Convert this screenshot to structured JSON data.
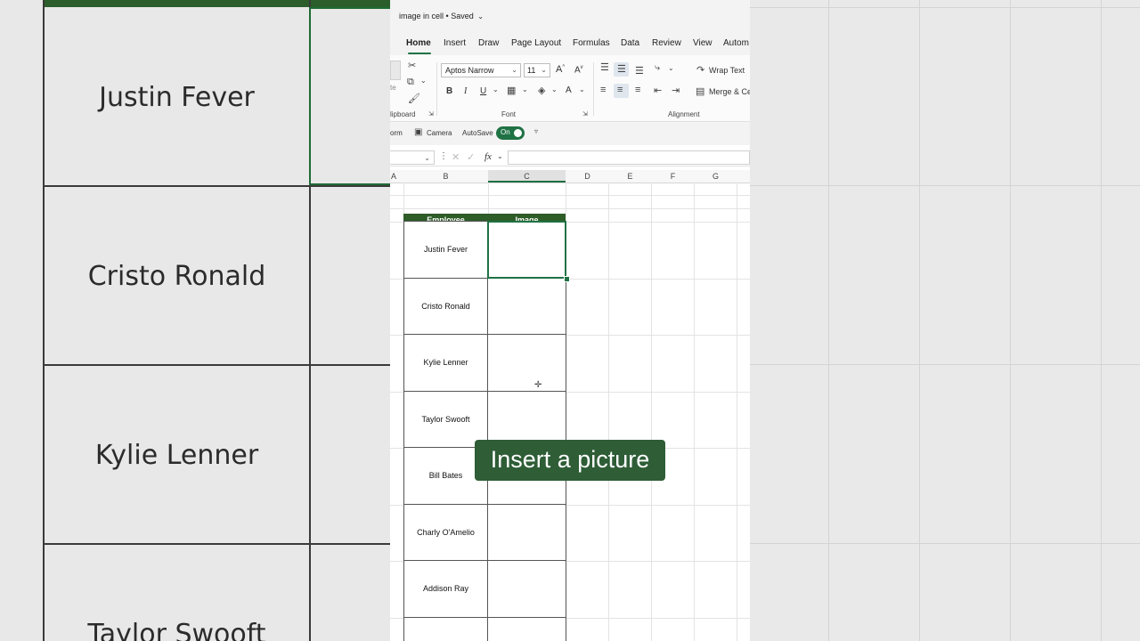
{
  "window": {
    "title": "image in cell",
    "saved_state": "• Saved"
  },
  "tabs": [
    "Home",
    "Insert",
    "Draw",
    "Page Layout",
    "Formulas",
    "Data",
    "Review",
    "View",
    "Autom"
  ],
  "active_tab": "Home",
  "ribbon": {
    "paste_partial": "te",
    "font_name": "Aptos Narrow",
    "font_size": "11",
    "wrap_text": "Wrap Text",
    "merge_partial": "Merge & Ce",
    "groups": {
      "clipboard": "lipboard",
      "font": "Font",
      "alignment": "Alignment"
    },
    "buttons": {
      "bold": "B",
      "italic": "I",
      "underline": "U",
      "grow_font": "A",
      "shrink_font": "A",
      "font_color": "A"
    }
  },
  "qat": {
    "form_partial": "orm",
    "camera": "Camera",
    "autosave": "AutoSave",
    "toggle_state": "On"
  },
  "formula_bar": {
    "fx": "fx"
  },
  "columns": [
    "A",
    "B",
    "C",
    "D",
    "E",
    "F",
    "G"
  ],
  "sheet": {
    "headers": {
      "employee": "Employee",
      "image": "Image"
    },
    "employees": [
      "Justin Fever",
      "Cristo Ronald",
      "Kylie Lenner",
      "Taylor Swooft",
      "Bill Bates",
      "Charly O'Amelio",
      "Addison Ray"
    ]
  },
  "background_zoom": {
    "names": [
      "Justin Fever",
      "Cristo Ronald",
      "Kylie Lenner",
      "Taylor Swooft"
    ]
  },
  "caption": "Insert a picture",
  "colors": {
    "excel_green": "#1f7244",
    "header_fill": "#2e5d27",
    "caption_bg": "#2e5d36"
  }
}
